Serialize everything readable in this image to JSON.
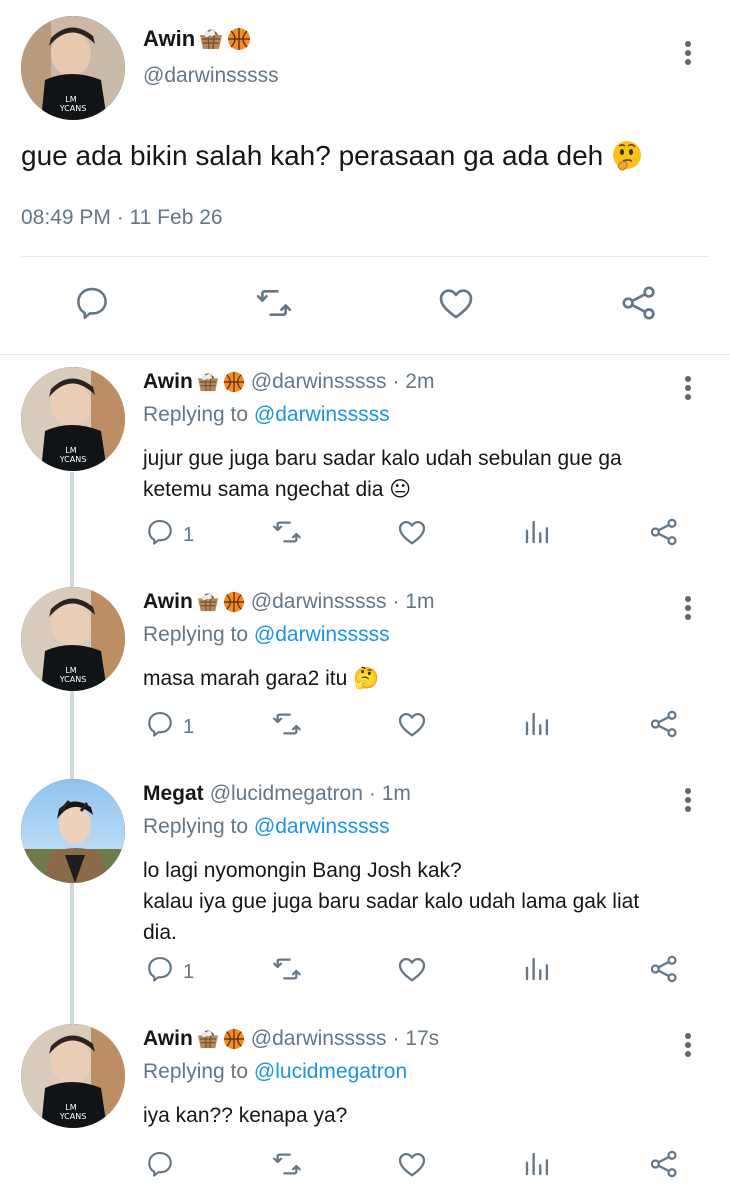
{
  "main": {
    "name": "Awin",
    "handle": "@darwinsssss",
    "text": "gue ada bikin salah kah? perasaan ga ada deh",
    "timestamp": "08:49 PM · 11 Feb 26"
  },
  "replies": [
    {
      "name": "Awin",
      "handle": "@darwinsssss",
      "time": "· 2m",
      "replying_prefix": "Replying to",
      "replying_to": "@darwinsssss",
      "lines": [
        "jujur gue juga baru sadar kalo udah sebulan gue ga",
        "ketemu sama ngechat dia 😐"
      ],
      "reply_count": "1"
    },
    {
      "name": "Awin",
      "handle": "@darwinsssss",
      "time": "· 1m",
      "replying_prefix": "Replying to",
      "replying_to": "@darwinsssss",
      "lines": [
        "masa marah gara2 itu 🤔"
      ],
      "reply_count": "1"
    },
    {
      "name": "Megat",
      "handle": "@lucidmegatron",
      "time": "· 1m",
      "replying_prefix": "Replying to",
      "replying_to": "@darwinsssss",
      "lines": [
        "lo lagi nyomongin Bang Josh kak?",
        "kalau iya gue juga baru sadar kalo udah lama gak liat",
        "dia."
      ],
      "reply_count": "1"
    },
    {
      "name": "Awin",
      "handle": "@darwinsssss",
      "time": "· 17s",
      "replying_prefix": "Replying to",
      "replying_to": "@lucidmegatron",
      "lines": [
        "iya kan?? kenapa ya?"
      ],
      "reply_count": ""
    }
  ],
  "colors": {
    "link": "#1b95e0",
    "secondary_text": "#657786",
    "icon": "#657786",
    "divider": "#e1e8ed"
  }
}
